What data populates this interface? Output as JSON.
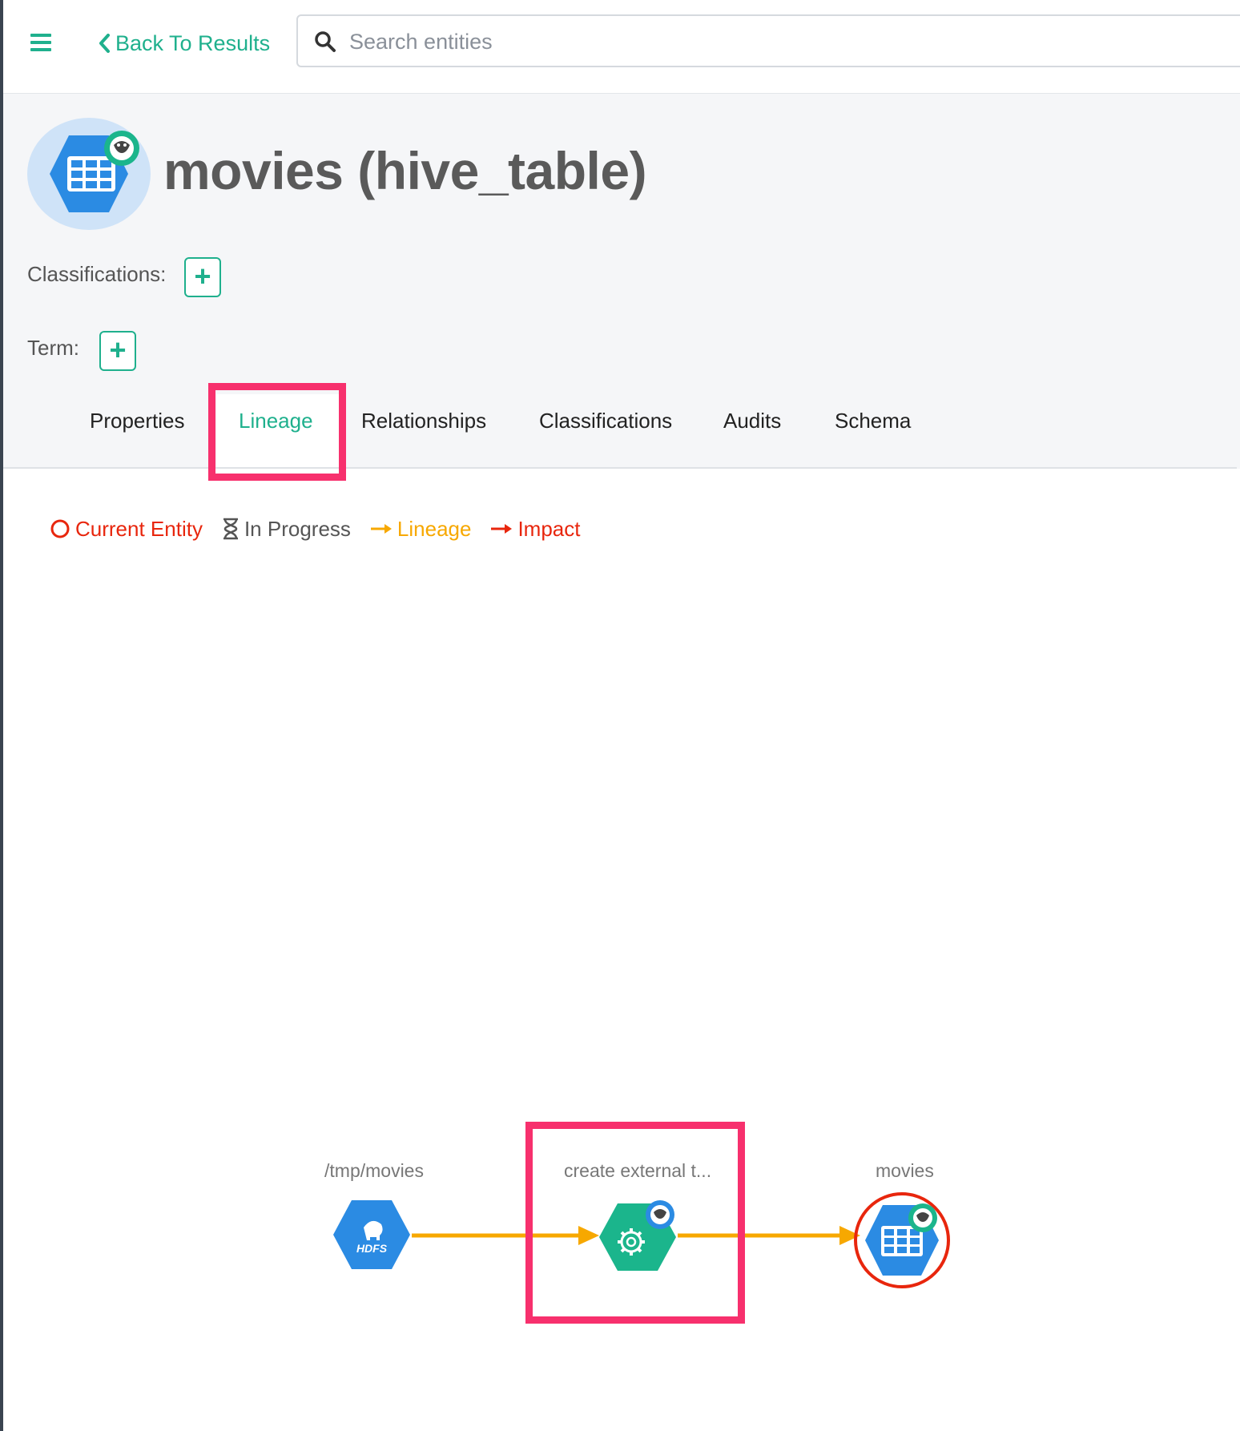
{
  "nav": {
    "back_label": "Back To Results",
    "search_placeholder": "Search entities"
  },
  "entity": {
    "title": "movies (hive_table)",
    "classifications_label": "Classifications:",
    "term_label": "Term:"
  },
  "tabs": [
    {
      "label": "Properties"
    },
    {
      "label": "Lineage",
      "active": true
    },
    {
      "label": "Relationships"
    },
    {
      "label": "Classifications"
    },
    {
      "label": "Audits"
    },
    {
      "label": "Schema"
    }
  ],
  "legend": {
    "current_entity": "Current Entity",
    "in_progress": "In Progress",
    "lineage": "Lineage",
    "impact": "Impact"
  },
  "lineage_graph": {
    "nodes": [
      {
        "label": "/tmp/movies",
        "badge": "HDFS",
        "type": "hdfs_path"
      },
      {
        "label": "create external t...",
        "type": "process"
      },
      {
        "label": "movies",
        "type": "hive_table",
        "current": true
      }
    ]
  },
  "colors": {
    "accent": "#1fb08d",
    "lineage_edge": "#f7a800",
    "impact": "#e8260d",
    "current_entity": "#e8260d",
    "annotation": "#f7306d",
    "table_node": "#2b8be3",
    "process_node": "#1bb58c"
  },
  "icons": {
    "menu": "hamburger-icon",
    "back": "chevron-left-icon",
    "search": "search-icon",
    "add": "plus-icon",
    "in_progress": "hourglass-icon"
  }
}
